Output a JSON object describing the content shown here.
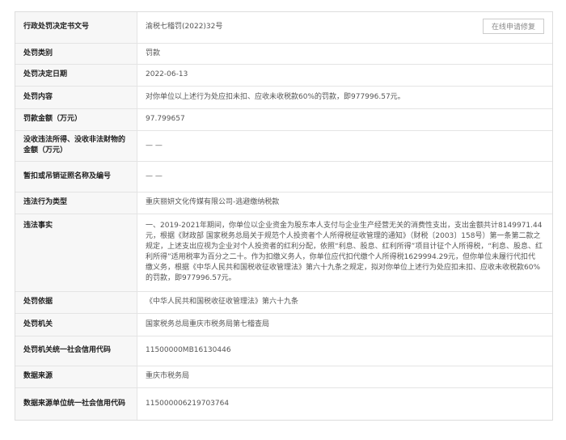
{
  "repair_button": "在线申请修复",
  "rows": [
    {
      "label": "行政处罚决定书文号",
      "value": "渝税七稽罚(2022)32号"
    },
    {
      "label": "处罚类别",
      "value": "罚款"
    },
    {
      "label": "处罚决定日期",
      "value": "2022-06-13"
    },
    {
      "label": "处罚内容",
      "value": "对你单位以上述行为处应扣未扣、应收未收税款60%的罚款，即977996.57元。"
    },
    {
      "label": "罚款金额（万元）",
      "value": "97.799657"
    },
    {
      "label": "没收违法所得、没收非法财物的金额（万元）",
      "value": "— —"
    },
    {
      "label": "暂扣或吊销证照名称及编号",
      "value": "— —"
    },
    {
      "label": "违法行为类型",
      "value": "重庆丽妍文化传媒有限公司-逃避缴纳税款"
    },
    {
      "label": "违法事实",
      "value": "一、2019-2021年期间，你单位以企业资金为股东本人支付与企业生产经营无关的消费性支出，支出金额共计8149971.44元，根据《财政部 国家税务总局关于规范个人投资者个人所得税征收管理的通知》（财税〔2003〕158号）第一条第二款之规定，上述支出应视为企业对个人投资者的红利分配，依照“利息、股息、红利所得”项目计征个人所得税，“利息、股息、红利所得”适用税率为百分之二十。作为扣缴义务人，你单位应代扣代缴个人所得税1629994.29元，但你单位未履行代扣代缴义务，根据《中华人民共和国税收征收管理法》第六十九条之规定，拟对你单位上述行为处应扣未扣、应收未收税款60%的罚款，即977996.57元。"
    },
    {
      "label": "处罚依据",
      "value": "《中华人民共和国税收征收管理法》第六十九条"
    },
    {
      "label": "处罚机关",
      "value": "国家税务总局重庆市税务局第七稽查局"
    },
    {
      "label": "处罚机关统一社会信用代码",
      "value": "11500000MB16130446"
    },
    {
      "label": "数据来源",
      "value": "重庆市税务局"
    },
    {
      "label": "数据来源单位统一社会信用代码",
      "value": "115000006219703764"
    }
  ]
}
